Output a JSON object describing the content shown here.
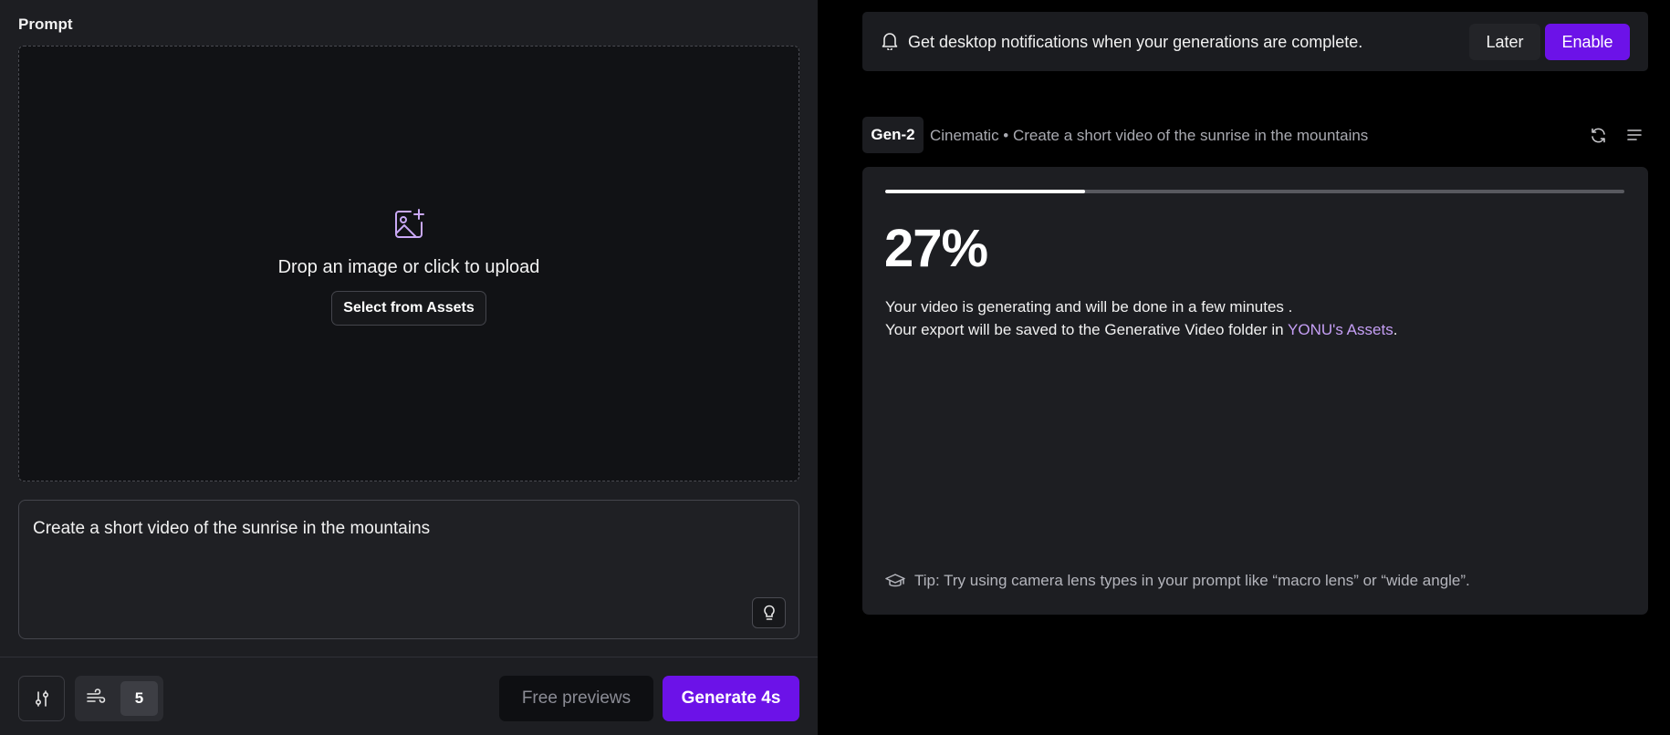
{
  "left": {
    "prompt_label": "Prompt",
    "dropzone": {
      "text": "Drop an image or click to upload",
      "select_button": "Select from Assets",
      "icon": "image-plus-icon"
    },
    "prompt_text": "Create a short video of the sunrise in the mountains",
    "footer": {
      "motion_value": "5",
      "free_previews": "Free previews",
      "generate": "Generate 4s"
    }
  },
  "right": {
    "notification": {
      "text": "Get desktop notifications when your generations are complete.",
      "later": "Later",
      "enable": "Enable"
    },
    "generation": {
      "model": "Gen-2",
      "title": "Cinematic • Create a short video of the sunrise in the mountains",
      "progress": 0.27,
      "percent": "27%",
      "status_line_1": "Your video is generating and will be done in a few minutes .",
      "status_line_2_prefix": "Your export will be saved to the Generative Video folder in ",
      "status_line_2_link": "YONU's Assets",
      "status_line_2_suffix": ".",
      "tip": "Tip: Try using camera lens types in your prompt like “macro lens” or “wide angle”."
    }
  },
  "colors": {
    "accent": "#6c12e8",
    "link": "#c59ff5",
    "panel": "#1d1e22",
    "background": "#000000"
  }
}
